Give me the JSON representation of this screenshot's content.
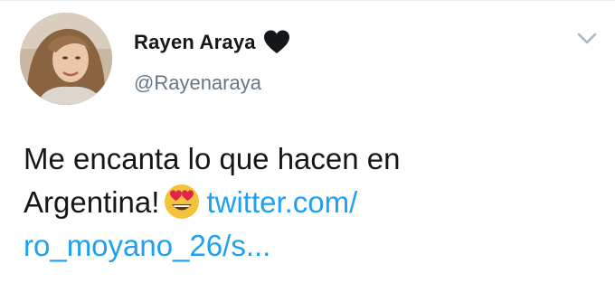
{
  "user": {
    "display_name": "Rayen Araya",
    "handle": "@Rayenaraya",
    "badge_icon": "black-heart-icon",
    "avatar_icon": "profile-photo"
  },
  "tweet": {
    "text_line1": "Me encanta lo que hacen en",
    "text_line2_prefix": "Argentina!",
    "emoji": "heart-eyes-emoji",
    "link_part1": "twitter.com/",
    "link_part2": "ro_moyano_26/s..."
  },
  "menu": {
    "caret_icon": "chevron-down-icon"
  },
  "colors": {
    "link": "#1da1f2",
    "handle": "#657786",
    "text": "#14171a",
    "heart": "#14171a"
  }
}
